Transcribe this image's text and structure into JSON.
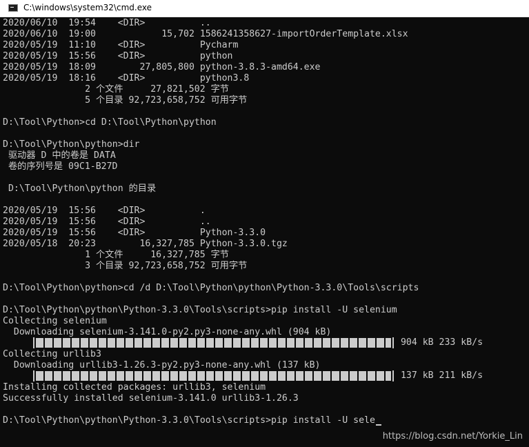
{
  "window": {
    "title": "C:\\windows\\system32\\cmd.exe",
    "icon": "console-icon"
  },
  "console": {
    "lines": [
      "2020/06/10  19:54    <DIR>          ..",
      "2020/06/10  19:00            15,702 1586241358627-importOrderTemplate.xlsx",
      "2020/05/19  11:10    <DIR>          Pycharm",
      "2020/05/19  15:56    <DIR>          python",
      "2020/05/19  18:09        27,805,800 python-3.8.3-amd64.exe",
      "2020/05/19  18:16    <DIR>          python3.8",
      "               2 个文件     27,821,502 字节",
      "               5 个目录 92,723,658,752 可用字节",
      "",
      "D:\\Tool\\Python>cd D:\\Tool\\Python\\python",
      "",
      "D:\\Tool\\Python\\python>dir",
      " 驱动器 D 中的卷是 DATA",
      " 卷的序列号是 09C1-B27D",
      "",
      " D:\\Tool\\Python\\python 的目录",
      "",
      "2020/05/19  15:56    <DIR>          .",
      "2020/05/19  15:56    <DIR>          ..",
      "2020/05/19  15:56    <DIR>          Python-3.3.0",
      "2020/05/18  20:23        16,327,785 Python-3.3.0.tgz",
      "               1 个文件     16,327,785 字节",
      "               3 个目录 92,723,658,752 可用字节",
      "",
      "D:\\Tool\\Python\\python>cd /d D:\\Tool\\Python\\python\\Python-3.3.0\\Tools\\scripts",
      "",
      "D:\\Tool\\Python\\python\\Python-3.3.0\\Tools\\scripts>pip install -U selenium",
      "Collecting selenium",
      "  Downloading selenium-3.141.0-py2.py3-none-any.whl (904 kB)",
      null,
      "Collecting urllib3",
      "  Downloading urllib3-1.26.3-py2.py3-none-any.whl (137 kB)",
      null,
      "Installing collected packages: urllib3, selenium",
      "Successfully installed selenium-3.141.0 urllib3-1.26.3",
      "",
      "D:\\Tool\\Python\\python\\Python-3.3.0\\Tools\\scripts>pip install -U sele"
    ],
    "progress": [
      {
        "fraction": 1.0,
        "stats": " 904 kB 233 kB/s"
      },
      {
        "fraction": 1.0,
        "stats": " 137 kB 211 kB/s"
      }
    ],
    "text_color": "#cccccc",
    "background": "#0c0c0c"
  },
  "watermark": "https://blog.csdn.net/Yorkie_Lin"
}
